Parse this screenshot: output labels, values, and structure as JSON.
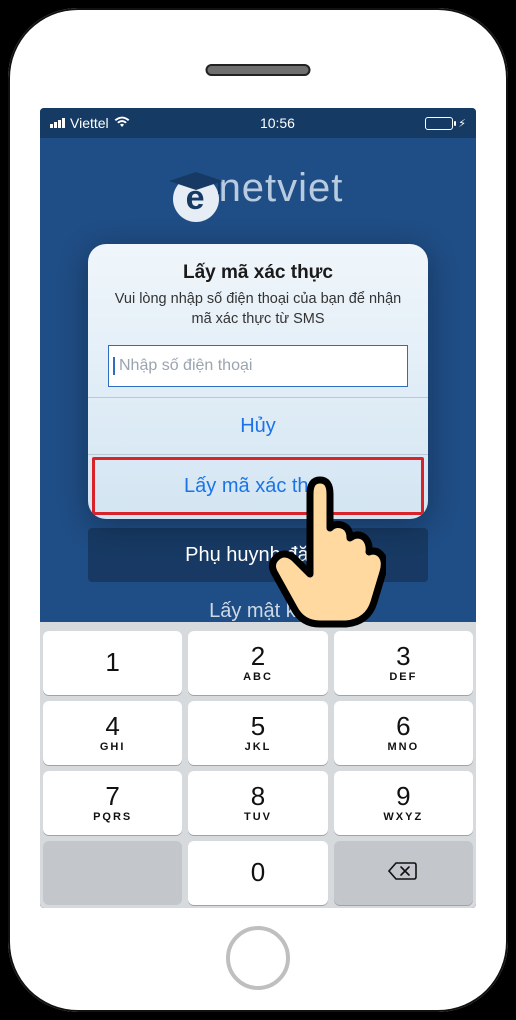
{
  "status_bar": {
    "carrier": "Viettel",
    "time": "10:56"
  },
  "app": {
    "brand": "netviet",
    "brand_initial": "e",
    "register_button": "Phụ huynh đăng",
    "forgot_password_link": "Lấy mật kh"
  },
  "modal": {
    "title": "Lấy mã xác thực",
    "message": "Vui lòng nhập số điện thoại của bạn để nhận mã xác thực từ SMS",
    "phone_placeholder": "Nhập số điện thoại",
    "cancel_label": "Hủy",
    "confirm_label": "Lấy mã xác thực"
  },
  "keypad": {
    "keys": [
      [
        {
          "num": "1",
          "sub": ""
        },
        {
          "num": "2",
          "sub": "ABC"
        },
        {
          "num": "3",
          "sub": "DEF"
        }
      ],
      [
        {
          "num": "4",
          "sub": "GHI"
        },
        {
          "num": "5",
          "sub": "JKL"
        },
        {
          "num": "6",
          "sub": "MNO"
        }
      ],
      [
        {
          "num": "7",
          "sub": "PQRS"
        },
        {
          "num": "8",
          "sub": "TUV"
        },
        {
          "num": "9",
          "sub": "WXYZ"
        }
      ],
      [
        {
          "num": "",
          "sub": ""
        },
        {
          "num": "0",
          "sub": ""
        },
        {
          "num": "",
          "sub": ""
        }
      ]
    ]
  }
}
